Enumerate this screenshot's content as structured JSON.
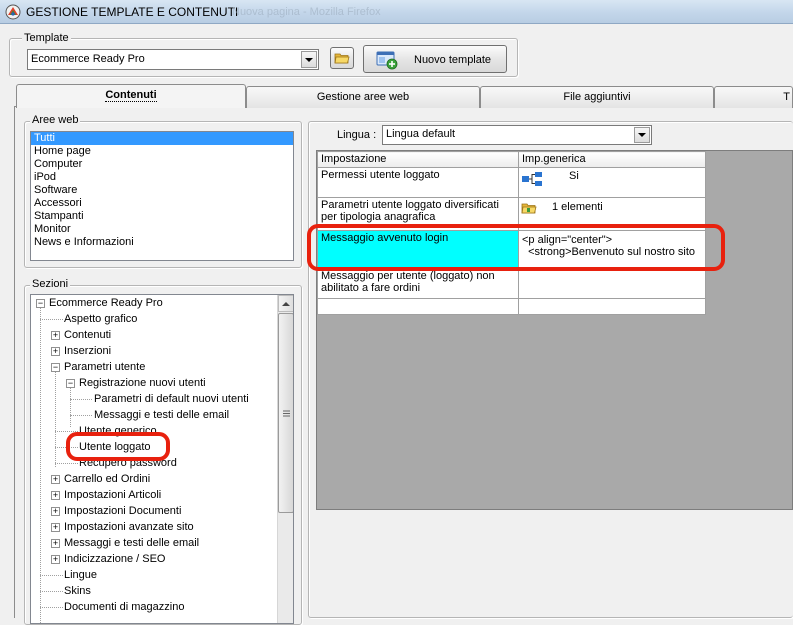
{
  "window": {
    "title": "GESTIONE TEMPLATE E CONTENUTI",
    "background_caption": "Nuova pagina - Mozilla Firefox"
  },
  "template": {
    "group_label": "Template",
    "selected": "Ecommerce Ready Pro",
    "folder_icon": "folder-icon",
    "new_template_label": "Nuovo template",
    "new_template_icon": "new-template-icon"
  },
  "tabs": [
    {
      "label": "Contenuti",
      "active": true
    },
    {
      "label": "Gestione aree web",
      "active": false
    },
    {
      "label": "File aggiuntivi",
      "active": false
    },
    {
      "label": "T",
      "active": false
    }
  ],
  "aree_web": {
    "label": "Aree web",
    "items": [
      "Tutti",
      "Home page",
      "Computer",
      "iPod",
      "Software",
      "Accessori",
      "Stampanti",
      "Monitor",
      "News e Informazioni"
    ],
    "selected_index": 0
  },
  "sezioni": {
    "label": "Sezioni",
    "tree": [
      {
        "label": "Ecommerce Ready Pro",
        "level": 0,
        "expander": "minus"
      },
      {
        "label": "Aspetto grafico",
        "level": 1,
        "expander": ""
      },
      {
        "label": "Contenuti",
        "level": 1,
        "expander": "plus"
      },
      {
        "label": "Inserzioni",
        "level": 1,
        "expander": "plus"
      },
      {
        "label": "Parametri utente",
        "level": 1,
        "expander": "minus"
      },
      {
        "label": "Registrazione nuovi utenti",
        "level": 2,
        "expander": "minus"
      },
      {
        "label": "Parametri di default nuovi utenti",
        "level": 3,
        "expander": ""
      },
      {
        "label": "Messaggi e testi delle email",
        "level": 3,
        "expander": ""
      },
      {
        "label": "Utente generico",
        "level": 2,
        "expander": ""
      },
      {
        "label": "Utente loggato",
        "level": 2,
        "expander": ""
      },
      {
        "label": "Recupero password",
        "level": 2,
        "expander": ""
      },
      {
        "label": "Carrello ed Ordini",
        "level": 1,
        "expander": "plus"
      },
      {
        "label": "Impostazioni Articoli",
        "level": 1,
        "expander": "plus"
      },
      {
        "label": "Impostazioni Documenti",
        "level": 1,
        "expander": "plus"
      },
      {
        "label": "Impostazioni avanzate sito",
        "level": 1,
        "expander": "plus"
      },
      {
        "label": "Messaggi e testi delle email",
        "level": 1,
        "expander": "plus"
      },
      {
        "label": "Indicizzazione / SEO",
        "level": 1,
        "expander": "plus"
      },
      {
        "label": "Lingue",
        "level": 1,
        "expander": ""
      },
      {
        "label": "Skins",
        "level": 1,
        "expander": ""
      },
      {
        "label": "Documenti di magazzino",
        "level": 1,
        "expander": ""
      }
    ]
  },
  "lingua": {
    "label": "Lingua :",
    "selected": "Lingua default"
  },
  "grid": {
    "headers": [
      "Impostazione",
      "Imp.generica"
    ],
    "rows": [
      {
        "name": "Permessi utente loggato",
        "value": "Si",
        "icon": "hierarchy-icon"
      },
      {
        "name": "Parametri utente loggato diversificati per tipologia anagrafica",
        "value": "1 elementi",
        "icon": "folder-icon"
      },
      {
        "name": "Messaggio avvenuto login",
        "value": "<p align=\"center\">\n  <strong>Benvenuto sul nostro sito",
        "icon": "",
        "highlight": true
      },
      {
        "name": "Messaggio per utente (loggato) non abilitato a fare ordini",
        "value": "",
        "icon": ""
      },
      {
        "name": "",
        "value": "",
        "icon": ""
      }
    ]
  },
  "colors": {
    "selection": "#3399ff",
    "highlight_cell": "#00ffff",
    "annotation": "#e8210e"
  }
}
